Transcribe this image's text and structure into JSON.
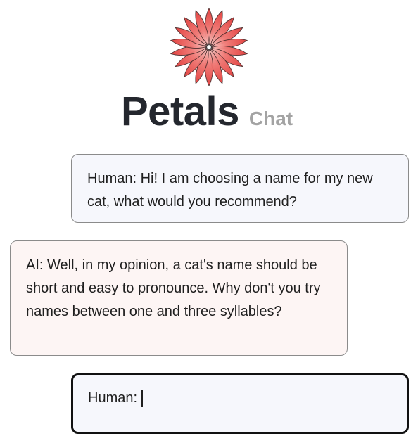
{
  "header": {
    "logo_icon": "flower-petals-icon",
    "title": "Petals",
    "subtitle": "Chat"
  },
  "conversation": {
    "messages": [
      {
        "role": "human",
        "text": "Human: Hi! I am choosing a name for my new cat, what would you recommend?"
      },
      {
        "role": "ai",
        "text": "AI: Well, in my opinion, a cat's name should be short and easy to pronounce. Why don't you try names between one and three syllables?"
      }
    ]
  },
  "composer": {
    "prefix": "Human:"
  },
  "colors": {
    "petal_red": "#e8413f",
    "human_bubble_bg": "#f6f7fc",
    "ai_bubble_bg": "#fdf5f4",
    "bubble_border": "#8b8b8b",
    "composer_border": "#111111",
    "subtitle_gray": "#a3a3a3"
  }
}
